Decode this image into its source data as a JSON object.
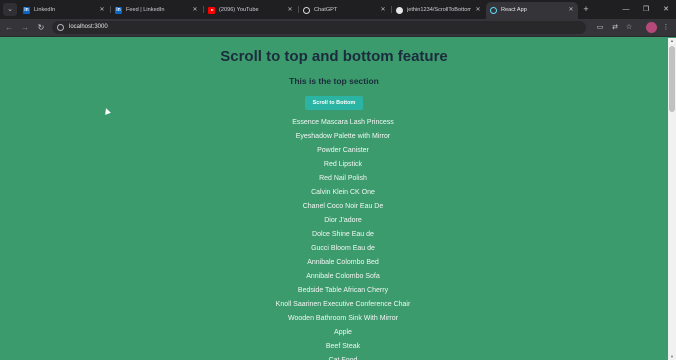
{
  "browser": {
    "tabs": [
      {
        "title": "LinkedIn",
        "icon": "linkedin-icon",
        "active": false
      },
      {
        "title": "Feed | LinkedIn",
        "icon": "linkedin-icon",
        "active": false
      },
      {
        "title": "(2096) YouTube",
        "icon": "youtube-icon",
        "active": false
      },
      {
        "title": "ChatGPT",
        "icon": "chatgpt-icon",
        "active": false
      },
      {
        "title": "jethin1234/ScrollToBottom-",
        "icon": "github-icon",
        "active": false
      },
      {
        "title": "React App",
        "icon": "react-icon",
        "active": true
      }
    ],
    "favicon_letter": "in",
    "url": "localhost:3000"
  },
  "page": {
    "title": "Scroll to top and bottom feature",
    "subtitle": "This is the top section",
    "scroll_button_label": "Scroll to Bottom",
    "items": [
      "Essence Mascara Lash Princess",
      "Eyeshadow Palette with Mirror",
      "Powder Canister",
      "Red Lipstick",
      "Red Nail Polish",
      "Calvin Klein CK One",
      "Chanel Coco Noir Eau De",
      "Dior J'adore",
      "Dolce Shine Eau de",
      "Gucci Bloom Eau de",
      "Annibale Colombo Bed",
      "Annibale Colombo Sofa",
      "Bedside Table African Cherry",
      "Knoll Saarinen Executive Conference Chair",
      "Wooden Bathroom Sink With Mirror",
      "Apple",
      "Beef Steak",
      "Cat Food"
    ]
  },
  "colors": {
    "page_background": "#3c9b6d",
    "heading_text": "#1b2c3d",
    "button_background": "#2bb3a3",
    "item_text": "#f3f7f5"
  }
}
